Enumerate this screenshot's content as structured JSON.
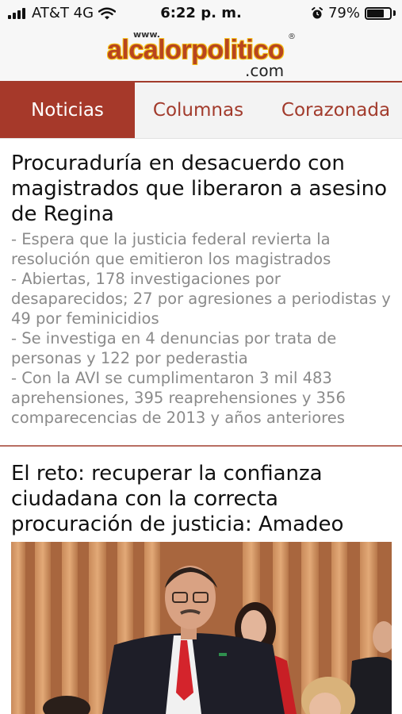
{
  "status_bar": {
    "carrier": "AT&T 4G",
    "time": "6:22 p. m.",
    "battery": "79%",
    "battery_level": 0.79,
    "icons": [
      "signal-icon",
      "wifi-icon",
      "alarm-icon",
      "battery-icon"
    ]
  },
  "header": {
    "logo_www": "www.",
    "logo_main": "alcalorpolitico",
    "logo_reg": "®",
    "logo_com": ".com"
  },
  "tabs": [
    {
      "label": "Noticias",
      "active": true
    },
    {
      "label": "Columnas",
      "active": false
    },
    {
      "label": "Corazonada",
      "active": false
    }
  ],
  "articles": [
    {
      "headline": "Procuraduría en desacuerdo con magistrados que liberaron a asesino de Regina",
      "bullets": [
        "- Espera que la justicia federal revierta la resolución que emitieron los magistrados",
        "- Abiertas, 178 investigaciones por desaparecidos; 27 por agresiones a periodistas y 49 por feminicidios",
        "- Se investiga en 4 denuncias por trata de personas y 122 por pederastia",
        "- Con la AVI se cumplimentaron 3 mil 483 aprehensiones, 395 reaprehensiones y 356 comparecencias de 2013 y años anteriores"
      ]
    },
    {
      "headline": "El reto: recuperar la confianza ciudadana con la correcta procuración de justicia: Amadeo"
    }
  ],
  "colors": {
    "brand": "#a6392a",
    "logo_orange": "#b8451f",
    "logo_yellow": "#f4c21c",
    "bullet_gray": "#8a8a8a"
  }
}
